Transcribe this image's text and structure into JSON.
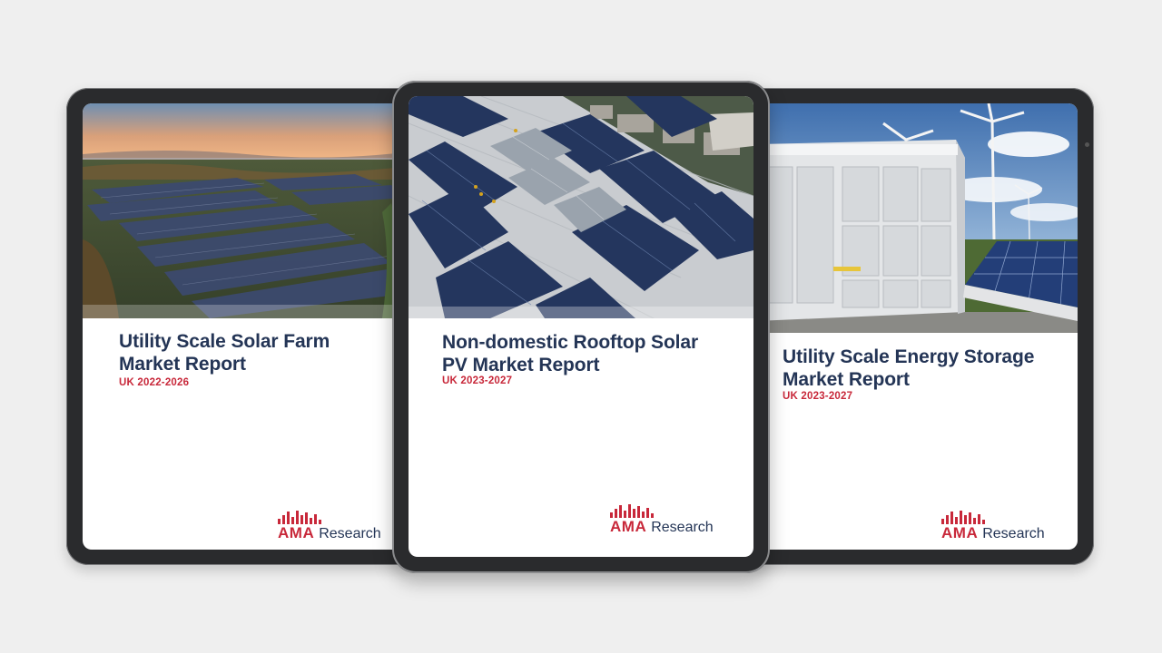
{
  "colors": {
    "background": "#efefef",
    "title": "#243556",
    "accent_red": "#c8283a",
    "bezel": "#2a2b2d"
  },
  "brand": {
    "logo_ama": "AMA",
    "logo_research": "Research"
  },
  "reports": [
    {
      "title_line1": "Utility Scale Solar Farm",
      "title_line2": "Market Report",
      "subtitle": "UK 2022-2026",
      "image": "solar-farm-landscape"
    },
    {
      "title_line1": "Non-domestic Rooftop Solar",
      "title_line2": "PV Market Report",
      "subtitle": "UK 2023-2027",
      "image": "rooftop-solar-panels"
    },
    {
      "title_line1": "Utility Scale Energy Storage",
      "title_line2": "Market Report",
      "subtitle": "UK 2023-2027",
      "image": "battery-storage-wind-turbines"
    }
  ]
}
